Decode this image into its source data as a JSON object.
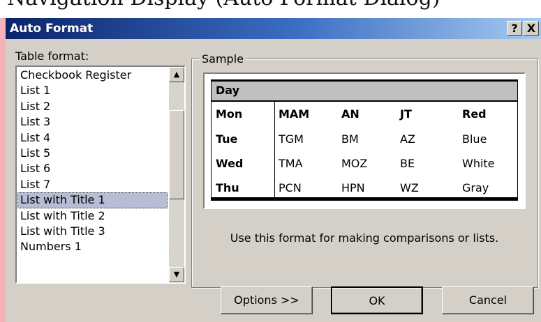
{
  "background_text": "Navigation Display (Auto Format Dialog)",
  "dialog": {
    "title": "Auto Format",
    "help_button": "?",
    "close_button": "X"
  },
  "table_format": {
    "label": "Table format:",
    "items": [
      "Checkbook Register",
      "List 1",
      "List 2",
      "List 3",
      "List 4",
      "List 5",
      "List 6",
      "List 7",
      "List with Title 1",
      "List with Title 2",
      "List with Title 3",
      "Numbers 1"
    ],
    "selected": "List with Title 1"
  },
  "sample": {
    "label": "Sample",
    "title_row": "Day",
    "rows": [
      [
        "Mon",
        "MAM",
        "AN",
        "JT",
        "Red"
      ],
      [
        "Tue",
        "TGM",
        "BM",
        "AZ",
        "Blue"
      ],
      [
        "Wed",
        "TMA",
        "MOZ",
        "BE",
        "White"
      ],
      [
        "Thu",
        "PCN",
        "HPN",
        "WZ",
        "Gray"
      ]
    ],
    "description": "Use this format for making comparisons or lists."
  },
  "buttons": {
    "options": "Options >>",
    "ok": "OK",
    "cancel": "Cancel"
  },
  "scrollbar": {
    "up_arrow": "▲",
    "down_arrow": "▼"
  }
}
